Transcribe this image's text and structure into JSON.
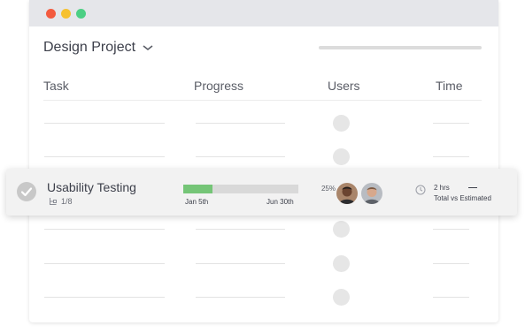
{
  "window": {
    "controls": [
      "close",
      "minimize",
      "zoom"
    ]
  },
  "project": {
    "title": "Design Project"
  },
  "table": {
    "columns": [
      "Task",
      "Progress",
      "Users",
      "Time"
    ]
  },
  "active_task": {
    "name": "Usability Testing",
    "subtasks": "1/8",
    "progress_label": "25%",
    "progress_value": 0.25,
    "start_date": "Jan 5th",
    "end_date": "Jun 30th",
    "time_total": "2 hrs",
    "time_compare": "Total vs Estimated",
    "estimated_placeholder": "—"
  },
  "colors": {
    "progress_fill": "#75c577",
    "progress_track": "#d9d9d9",
    "close": "#f35b3f",
    "minimize": "#f6c12f",
    "zoom": "#4ccf84"
  },
  "icons": {
    "title_chevron": "chevron-down-icon",
    "task_check": "check-circle-icon",
    "subtasks": "subtasks-icon",
    "time": "clock-icon"
  }
}
